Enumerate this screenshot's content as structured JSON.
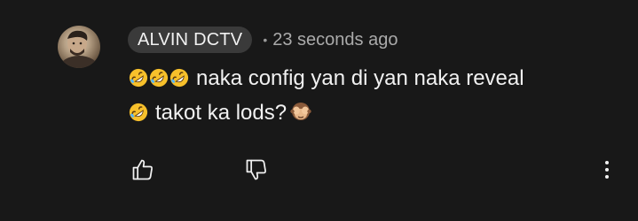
{
  "comment": {
    "author": "ALVIN DCTV",
    "separator": "•",
    "timestamp": "23 seconds ago",
    "line1_text": "naka config yan di yan naka reveal",
    "line2_text": "takot ka lods?",
    "emojis": {
      "laughing": "rolling-on-floor-laughing-emoji",
      "monkey": "see-no-evil-monkey-emoji"
    }
  },
  "actions": {
    "like_icon": "thumbs-up-icon",
    "dislike_icon": "thumbs-down-icon",
    "more_icon": "more-vertical-icon"
  },
  "colors": {
    "background": "#181818",
    "chip": "#3a3a3a",
    "text": "#f1f1f1",
    "muted": "#aaaaaa"
  }
}
